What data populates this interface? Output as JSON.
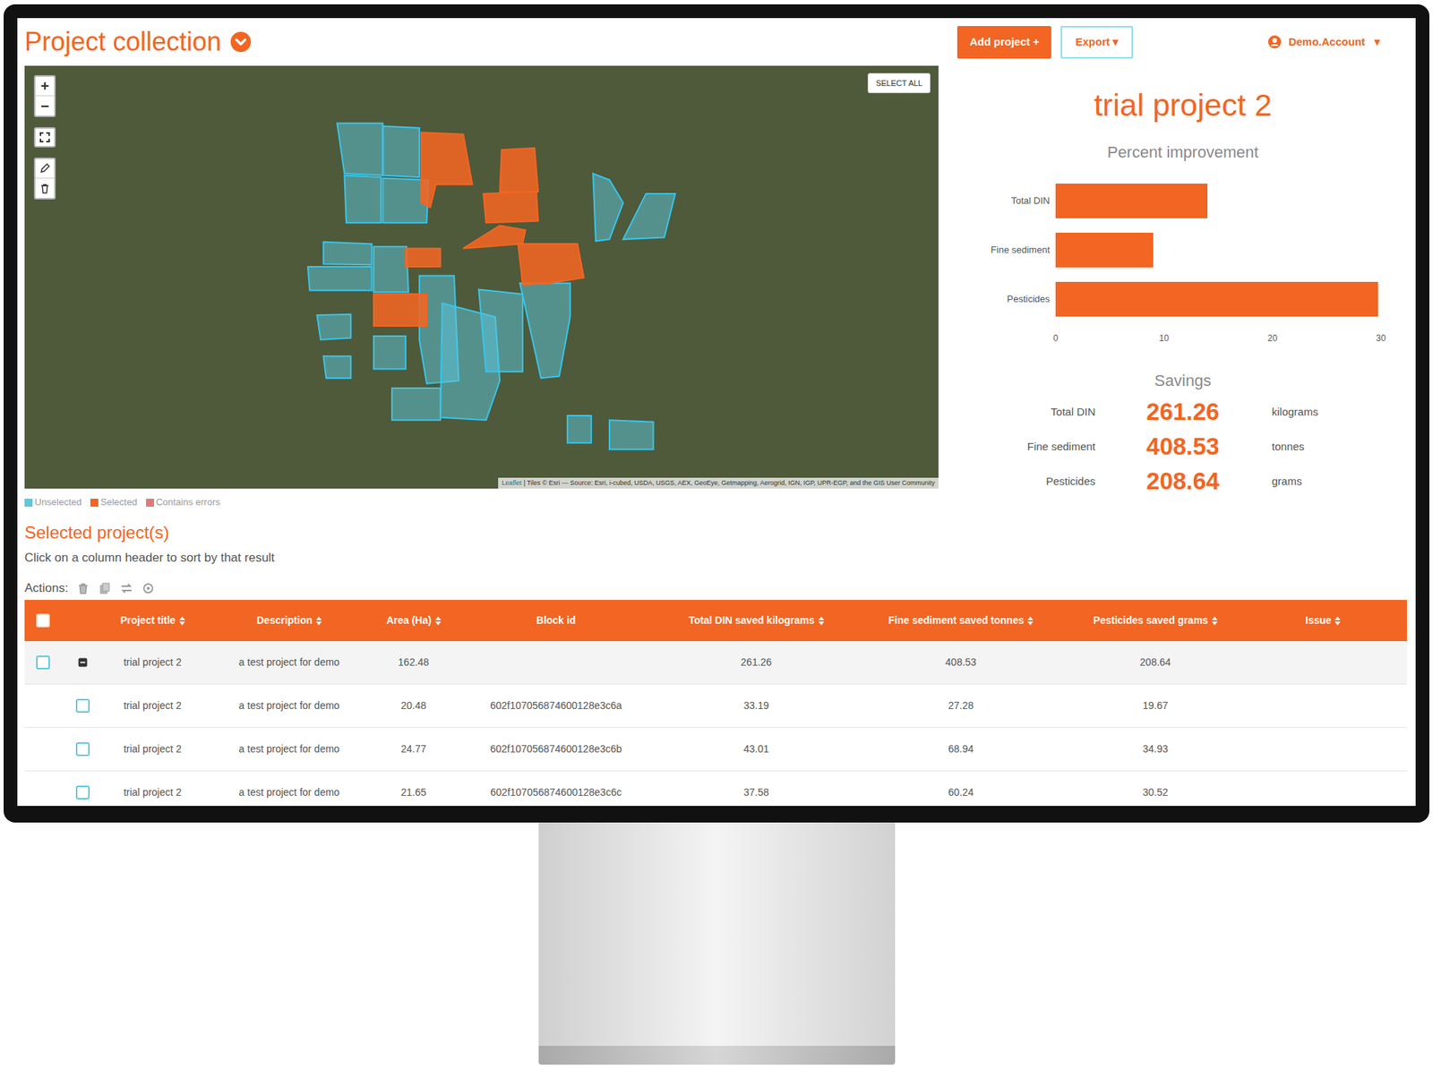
{
  "header": {
    "title": "Project collection",
    "add_button": "Add project +",
    "export_button": "Export ▾",
    "account": {
      "name": "Demo.Account",
      "caret": "▾"
    }
  },
  "map": {
    "zoom_in": "+",
    "zoom_out": "−",
    "select_all": "SELECT ALL",
    "attribution": {
      "link": "Leaflet",
      "text": "| Tiles © Esri — Source: Esri, i-cubed, USDA, USGS, AEX, GeoEye, Getmapping, Aerogrid, IGN, IGP, UPR-EGP, and the GIS User Community"
    },
    "blocks": [
      {
        "selected": false
      },
      {
        "selected": false
      },
      {
        "selected": false
      },
      {
        "selected": false
      },
      {
        "selected": false
      },
      {
        "selected": false
      },
      {
        "selected": false
      },
      {
        "selected": false
      },
      {
        "selected": false
      },
      {
        "selected": false
      },
      {
        "selected": false
      },
      {
        "selected": false
      },
      {
        "selected": false
      },
      {
        "selected": false
      },
      {
        "selected": false
      },
      {
        "selected": false
      },
      {
        "selected": false
      },
      {
        "selected": false
      },
      {
        "selected": false
      },
      {
        "selected": true
      },
      {
        "selected": true
      },
      {
        "selected": true
      },
      {
        "selected": true
      },
      {
        "selected": true
      },
      {
        "selected": true
      },
      {
        "selected": true
      }
    ]
  },
  "legend": [
    {
      "label": "Unselected",
      "color": "#5bc8e0"
    },
    {
      "label": "Selected",
      "color": "#f26522"
    },
    {
      "label": "Contains errors",
      "color": "#e07a7a"
    }
  ],
  "summary": {
    "title": "trial project 2",
    "chart": {
      "title": "Percent improvement",
      "categories": [
        "Total DIN",
        "Fine sediment",
        "Pesticides"
      ],
      "values": [
        14,
        9,
        29.7
      ],
      "ticks": [
        "0",
        "10",
        "20",
        "30"
      ]
    },
    "savings": {
      "title": "Savings",
      "rows": [
        {
          "label": "Total DIN",
          "value": "261.26",
          "unit": "kilograms"
        },
        {
          "label": "Fine sediment",
          "value": "408.53",
          "unit": "tonnes"
        },
        {
          "label": "Pesticides",
          "value": "208.64",
          "unit": "grams"
        }
      ]
    }
  },
  "selection": {
    "title": "Selected project(s)",
    "hint": "Click on a column header to sort by that result",
    "actions_label": "Actions:"
  },
  "table": {
    "select_all_checked": false,
    "columns": [
      {
        "label": "Project title",
        "sortable": true
      },
      {
        "label": "Description",
        "sortable": true
      },
      {
        "label": "Area (Ha)",
        "sortable": true
      },
      {
        "label": "Block id",
        "sortable": false
      },
      {
        "label": "Total DIN saved kilograms",
        "sortable": true
      },
      {
        "label": "Fine sediment saved tonnes",
        "sortable": true
      },
      {
        "label": "Pesticides saved grams",
        "sortable": true
      },
      {
        "label": "Issue",
        "sortable": true
      }
    ],
    "rows": [
      {
        "kind": "group",
        "checked": false,
        "expanded": true,
        "cells": [
          "trial project 2",
          "a test project for demo",
          "162.48",
          "",
          "261.26",
          "408.53",
          "208.64",
          ""
        ]
      },
      {
        "kind": "block",
        "checked": false,
        "cells": [
          "trial project 2",
          "a test project for demo",
          "20.48",
          "602f107056874600128e3c6a",
          "33.19",
          "27.28",
          "19.67",
          ""
        ]
      },
      {
        "kind": "block",
        "checked": false,
        "cells": [
          "trial project 2",
          "a test project for demo",
          "24.77",
          "602f107056874600128e3c6b",
          "43.01",
          "68.94",
          "34.93",
          ""
        ]
      },
      {
        "kind": "block",
        "checked": false,
        "cells": [
          "trial project 2",
          "a test project for demo",
          "21.65",
          "602f107056874600128e3c6c",
          "37.58",
          "60.24",
          "30.52",
          ""
        ]
      }
    ]
  }
}
